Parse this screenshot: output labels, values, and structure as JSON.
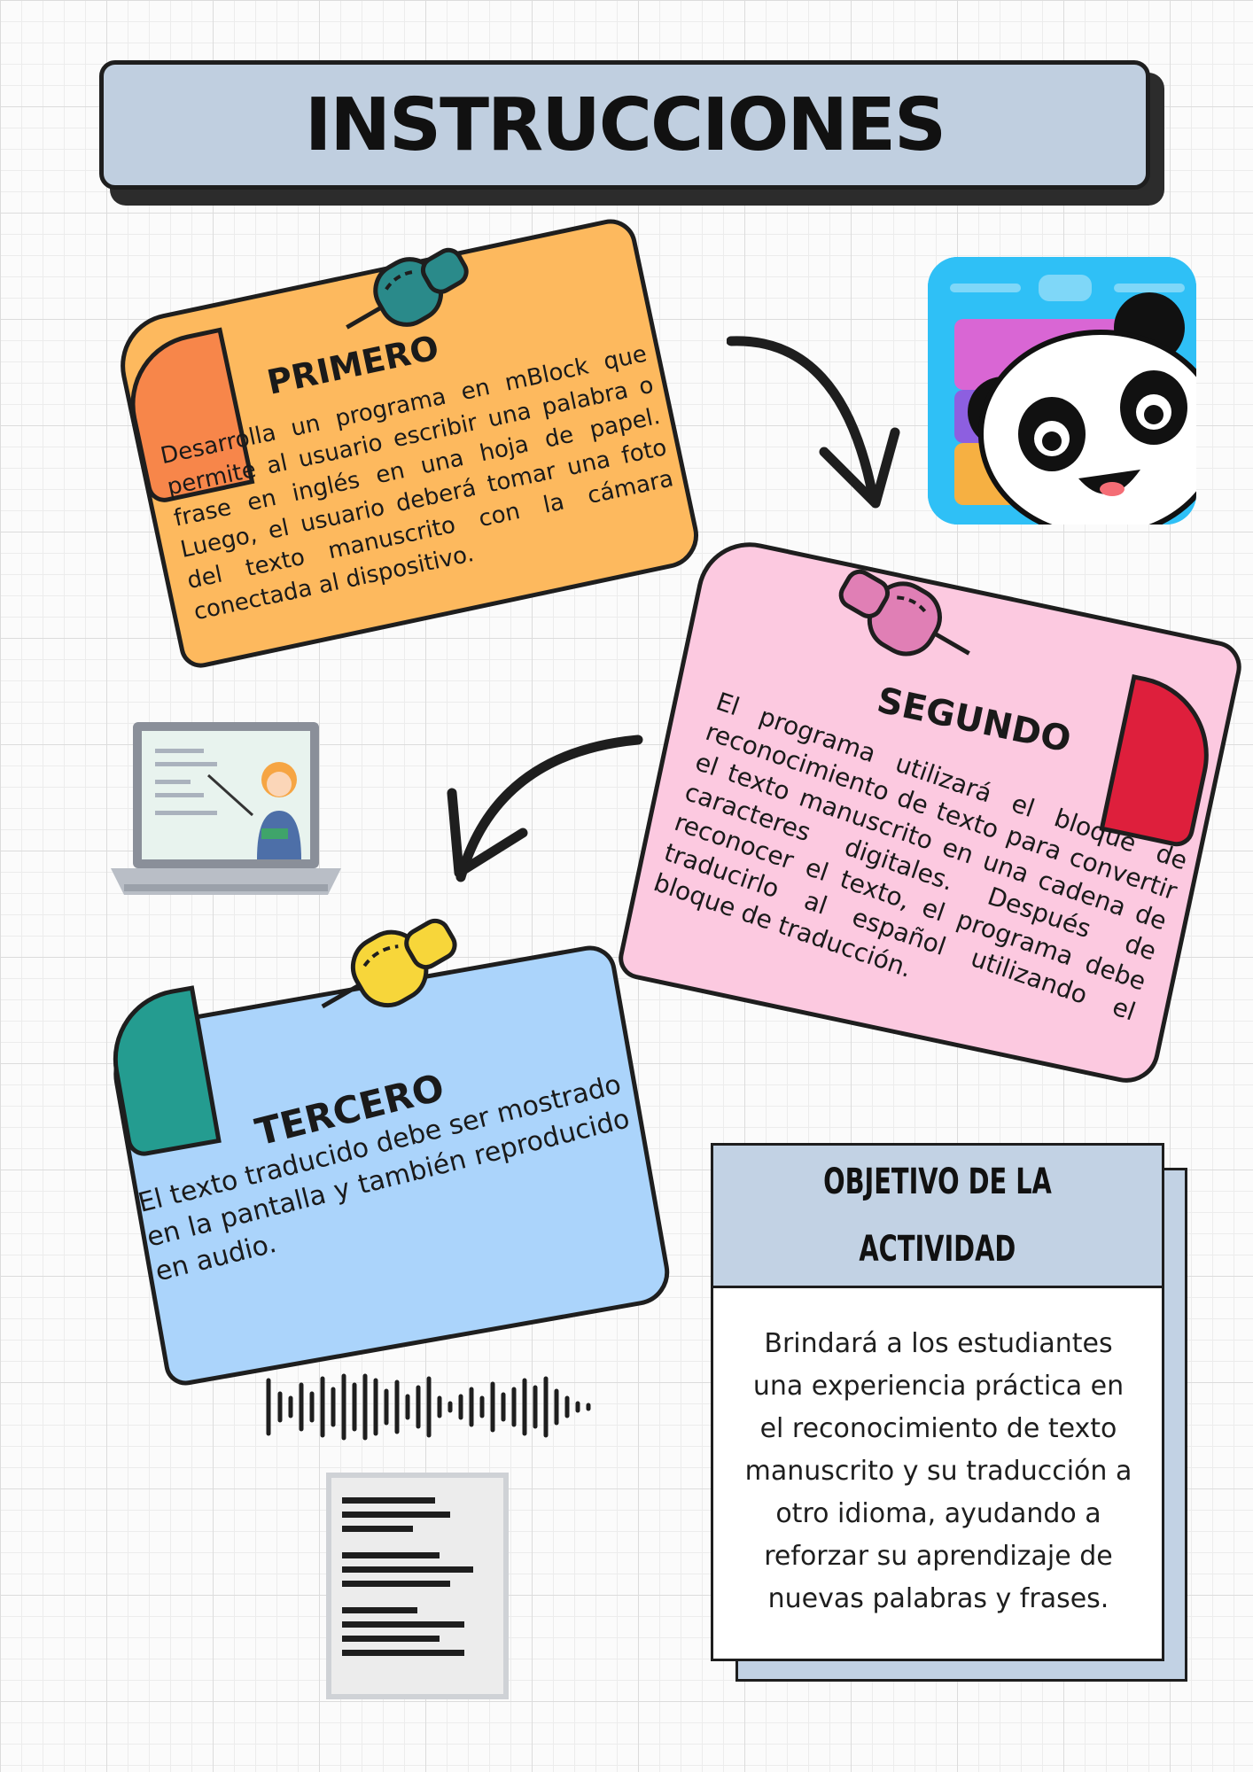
{
  "title": "INSTRUCCIONES",
  "steps": [
    {
      "title": "PRIMERO",
      "text": "Desarrolla un programa en mBlock que permite al usuario escribir una palabra o frase en inglés en una hoja de papel. Luego, el usuario deberá tomar una foto del texto manuscrito con la cámara conectada al dispositivo.",
      "color": "#fdb95e",
      "pin_color": "#2a8a8a"
    },
    {
      "title": "SEGUNDO",
      "text": "El programa utilizará el bloque de reconocimiento de texto para convertir el texto manuscrito en una cadena de caracteres digitales. Después de reconocer el texto, el programa debe traducirlo al español utilizando el bloque de traducción.",
      "color": "#fcc9e0",
      "pin_color": "#e07fb5"
    },
    {
      "title": "TERCERO",
      "text": "El texto traducido debe ser mostrado en la pantalla y también reproducido en audio.",
      "color": "#abd4fb",
      "pin_color": "#f7d63a"
    }
  ],
  "objective": {
    "heading_line1": "OBJETIVO DE LA",
    "heading_line2": "ACTIVIDAD",
    "body": "Brindará a los estudiantes una experiencia práctica en el reconocimiento de texto manuscrito y su traducción a otro idioma, ayudando a reforzar su aprendizaje de nuevas palabras y frases."
  },
  "icons": [
    "pushpin-icon",
    "mblock-panda-logo",
    "teacher-laptop-icon",
    "sound-wave-icon",
    "document-icon",
    "curved-arrow-icon"
  ]
}
